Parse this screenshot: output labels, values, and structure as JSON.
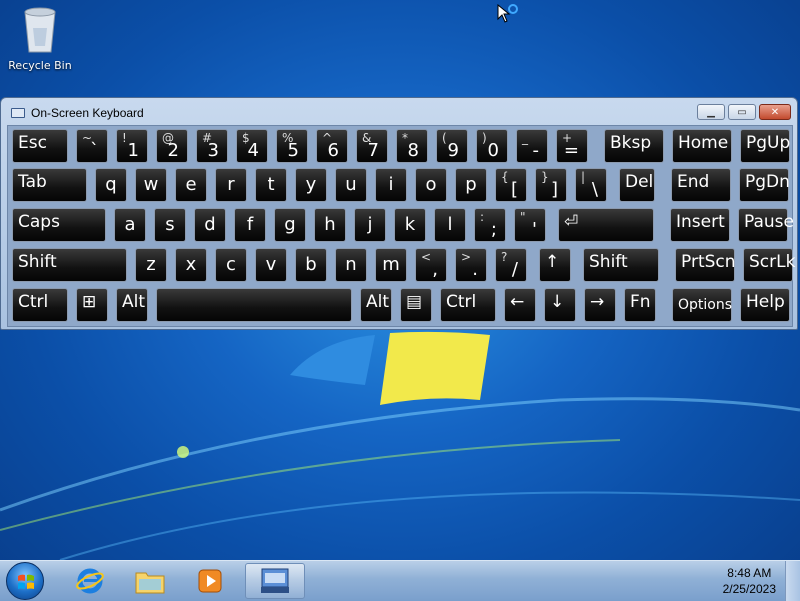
{
  "desktop": {
    "icons": [
      {
        "label": "Recycle Bin",
        "icon": "recycle-bin-icon"
      }
    ]
  },
  "osk": {
    "title": "On-Screen Keyboard",
    "icon": "keyboard-icon",
    "controls": {
      "minimize": "minimize-icon",
      "maximize": "maximize-icon",
      "close": "close-icon"
    },
    "rows": [
      [
        {
          "label": "Esc"
        },
        {
          "sym": "~",
          "main": "`"
        },
        {
          "sym": "!",
          "main": "1"
        },
        {
          "sym": "@",
          "main": "2"
        },
        {
          "sym": "#",
          "main": "3"
        },
        {
          "sym": "$",
          "main": "4"
        },
        {
          "sym": "%",
          "main": "5"
        },
        {
          "sym": "^",
          "main": "6"
        },
        {
          "sym": "&",
          "main": "7"
        },
        {
          "sym": "*",
          "main": "8"
        },
        {
          "sym": "(",
          "main": "9"
        },
        {
          "sym": ")",
          "main": "0"
        },
        {
          "sym": "_",
          "main": "-"
        },
        {
          "sym": "+",
          "main": "="
        },
        {
          "label": "Bksp"
        },
        {
          "label": "Home"
        },
        {
          "label": "PgUp"
        }
      ],
      [
        {
          "label": "Tab"
        },
        {
          "center": "q"
        },
        {
          "center": "w"
        },
        {
          "center": "e"
        },
        {
          "center": "r"
        },
        {
          "center": "t"
        },
        {
          "center": "y"
        },
        {
          "center": "u"
        },
        {
          "center": "i"
        },
        {
          "center": "o"
        },
        {
          "center": "p"
        },
        {
          "sym": "{",
          "main": "["
        },
        {
          "sym": "}",
          "main": "]"
        },
        {
          "sym": "|",
          "main": "\\"
        },
        {
          "label": "Del"
        },
        {
          "label": "End"
        },
        {
          "label": "PgDn"
        }
      ],
      [
        {
          "label": "Caps"
        },
        {
          "center": "a"
        },
        {
          "center": "s"
        },
        {
          "center": "d"
        },
        {
          "center": "f"
        },
        {
          "center": "g"
        },
        {
          "center": "h"
        },
        {
          "center": "j"
        },
        {
          "center": "k"
        },
        {
          "center": "l"
        },
        {
          "sym": ":",
          "main": ";"
        },
        {
          "sym": "\"",
          "main": "'"
        },
        {
          "label": "⏎"
        },
        {
          "label": "Insert"
        },
        {
          "label": "Pause"
        }
      ],
      [
        {
          "label": "Shift"
        },
        {
          "center": "z"
        },
        {
          "center": "x"
        },
        {
          "center": "c"
        },
        {
          "center": "v"
        },
        {
          "center": "b"
        },
        {
          "center": "n"
        },
        {
          "center": "m"
        },
        {
          "sym": "<",
          "main": ","
        },
        {
          "sym": ">",
          "main": "."
        },
        {
          "sym": "?",
          "main": "/"
        },
        {
          "label": "↑"
        },
        {
          "label": "Shift"
        },
        {
          "label": "PrtScn"
        },
        {
          "label": "ScrLk"
        }
      ],
      [
        {
          "label": "Ctrl"
        },
        {
          "label": "⊞"
        },
        {
          "label": "Alt"
        },
        {
          "label": ""
        },
        {
          "label": "Alt"
        },
        {
          "label": "▤"
        },
        {
          "label": "Ctrl"
        },
        {
          "label": "←"
        },
        {
          "label": "↓"
        },
        {
          "label": "→"
        },
        {
          "label": "Fn"
        },
        {
          "label": "Options"
        },
        {
          "label": "Help"
        }
      ]
    ]
  },
  "taskbar": {
    "start": "windows-logo-icon",
    "pinned": [
      {
        "name": "internet-explorer",
        "icon": "internet-explorer-icon"
      },
      {
        "name": "windows-explorer",
        "icon": "folder-icon"
      },
      {
        "name": "media-player",
        "icon": "media-player-icon"
      },
      {
        "name": "on-screen-keyboard",
        "icon": "on-screen-keyboard-icon",
        "active": true
      }
    ],
    "clock": {
      "time": "8:48 AM",
      "date": "2/25/2023"
    }
  }
}
